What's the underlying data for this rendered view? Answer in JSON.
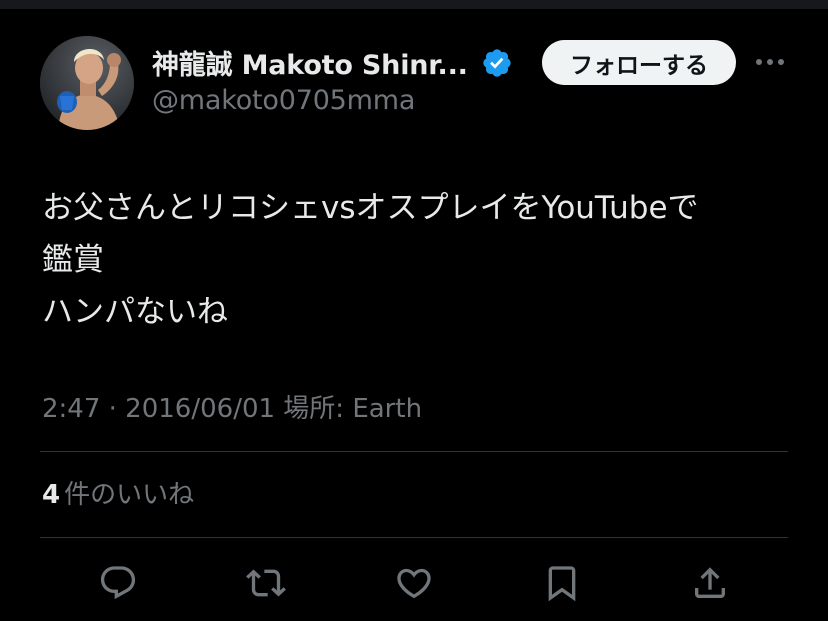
{
  "colors": {
    "background": "#000000",
    "text_primary": "#e7e9ea",
    "text_secondary": "#71767b",
    "divider": "#2f3336",
    "follow_button_bg": "#eff3f4",
    "follow_button_text": "#0f1419",
    "verified_badge": "#1d9bf0"
  },
  "author": {
    "display_name": "神龍誠 Makoto Shinr...",
    "handle": "@makoto0705mma",
    "verified": true,
    "avatar_icon": "avatar-photo"
  },
  "header": {
    "follow_label": "フォローする",
    "more_icon": "more-horizontal-icon"
  },
  "tweet": {
    "lines": [
      "お父さんとリコシェvsオスプレイをYouTubeで",
      "鑑賞",
      "ハンパないね"
    ],
    "meta": "2:47 · 2016/06/01 場所: Earth"
  },
  "engagement": {
    "likes_count": "4",
    "likes_label": "件のいいね"
  },
  "actions": [
    {
      "name": "reply",
      "icon": "reply-icon"
    },
    {
      "name": "retweet",
      "icon": "retweet-icon"
    },
    {
      "name": "like",
      "icon": "like-icon"
    },
    {
      "name": "bookmark",
      "icon": "bookmark-icon"
    },
    {
      "name": "share",
      "icon": "share-icon"
    }
  ]
}
